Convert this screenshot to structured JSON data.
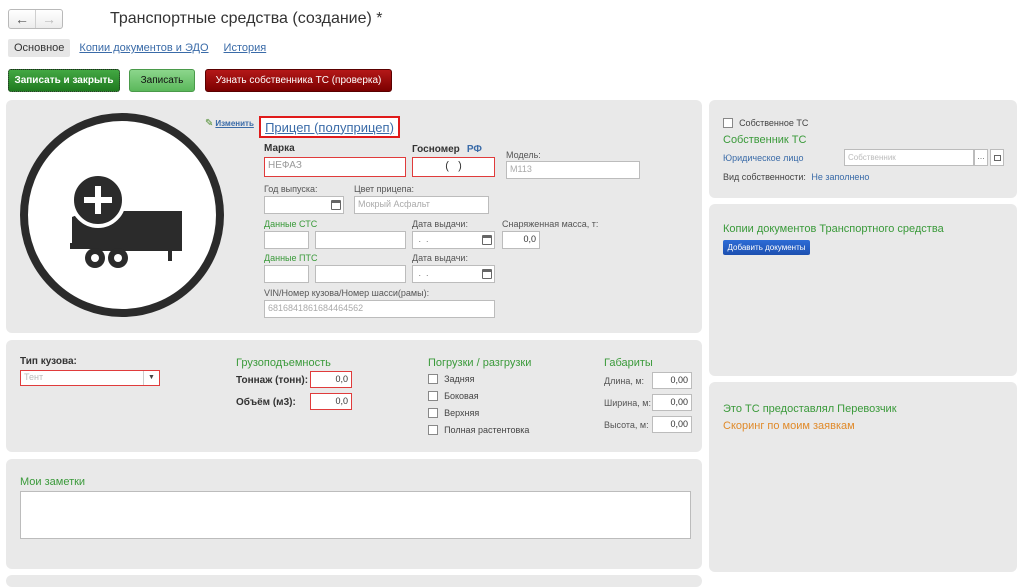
{
  "header": {
    "title": "Транспортные средства (создание) *",
    "back_icon": "←",
    "forward_icon": "→"
  },
  "tabs": [
    {
      "label": "Основное",
      "active": true
    },
    {
      "label": "Копии документов и ЭДО",
      "active": false
    },
    {
      "label": "История",
      "active": false
    }
  ],
  "toolbar": {
    "save_close_label": "Записать и закрыть",
    "save_label": "Записать",
    "check_owner_label": "Узнать собственника ТС (проверка)"
  },
  "vehicle": {
    "change_link": "Изменить",
    "type_label": "Прицеп (полуприцеп)",
    "brand_label": "Марка",
    "brand_value": "НЕФАЗ",
    "plate_label": "Госномер",
    "plate_region": "РФ",
    "plate_value": "(   )",
    "model_label": "Модель:",
    "model_placeholder": "М113",
    "year_label": "Год выпуска:",
    "year_value": "",
    "color_label": "Цвет прицепа:",
    "color_placeholder": "Мокрый Асфальт",
    "sts_label": "Данные СТС",
    "sts_date_label": "Дата выдачи:",
    "sts_date_value": " .  .",
    "curb_weight_label": "Снаряженная масса, т:",
    "curb_weight_value": "0,0",
    "pts_label": "Данные ПТС",
    "pts_date_label": "Дата выдачи:",
    "pts_date_value": " .  .",
    "vin_label": "VIN/Номер кузова/Номер шасси(рамы):",
    "vin_placeholder": "6816841861684464562"
  },
  "owner": {
    "own_checkbox_label": "Собственное ТС",
    "section_title": "Собственник ТС",
    "entity_type": "Юридическое лицо",
    "owner_placeholder": "Собственник",
    "ownership_label": "Вид собственности:",
    "ownership_value": "Не заполнено"
  },
  "docs": {
    "title": "Копии документов Транспортного средства",
    "add_button": "Добавить документы"
  },
  "carrier": {
    "provided_by": "Это ТС предоставлял Перевозчик",
    "scoring": "Скоринг по моим заявкам"
  },
  "specs": {
    "body_type_label": "Тип кузова:",
    "body_type_placeholder": "Тент",
    "capacity_title": "Грузоподъемность",
    "tonnage_label": "Тоннаж (тонн):",
    "tonnage_value": "0,0",
    "volume_label": "Объём (м3):",
    "volume_value": "0,0",
    "loading_title": "Погрузки / разгрузки",
    "loading_options": [
      "Задняя",
      "Боковая",
      "Верхняя",
      "Полная растентовка"
    ],
    "dims_title": "Габариты",
    "length_label": "Длина, м:",
    "length_value": "0,00",
    "width_label": "Ширина, м:",
    "width_value": "0,00",
    "height_label": "Высота, м:",
    "height_value": "0,00"
  },
  "notes": {
    "title": "Мои заметки",
    "value": ""
  },
  "colors": {
    "accent_green": "#3a9a3a",
    "link_blue": "#3a6ba8",
    "error_red": "#e03b3b",
    "danger_button": "#9b0d0d",
    "scoring_orange": "#e08a2a"
  }
}
